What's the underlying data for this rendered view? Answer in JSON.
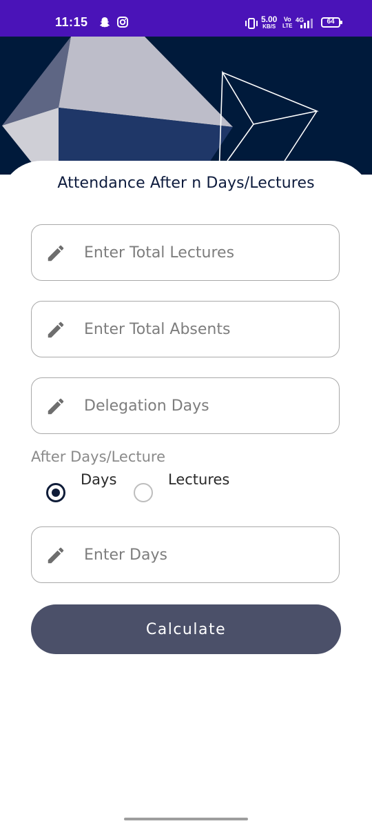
{
  "status_bar": {
    "time": "11:15",
    "speed_value": "5.00",
    "speed_unit": "KB/S",
    "volte_top": "Vo",
    "volte_bottom": "LTE",
    "network": "4G",
    "battery": "64",
    "background_color": "#4a13b8",
    "icons": [
      "snapchat-icon",
      "instagram-icon",
      "vibrate-icon",
      "signal-icon",
      "battery-icon"
    ]
  },
  "page": {
    "title": "Attendance After n Days/Lectures"
  },
  "form": {
    "total_lectures": {
      "placeholder": "Enter Total Lectures",
      "value": "",
      "icon": "pencil-icon"
    },
    "total_absents": {
      "placeholder": "Enter Total Absents",
      "value": "",
      "icon": "pencil-icon"
    },
    "delegation_days": {
      "placeholder": "Delegation Days",
      "value": "",
      "icon": "pencil-icon"
    },
    "section_label": "After Days/Lecture",
    "options": [
      {
        "label": "Days",
        "selected": true
      },
      {
        "label": "Lectures",
        "selected": false
      }
    ],
    "enter_days": {
      "placeholder": "Enter Days",
      "value": "",
      "icon": "pencil-icon"
    }
  },
  "actions": {
    "calculate_label": "Calculate",
    "button_color": "#4b5069"
  },
  "colors": {
    "hero_background": "#001a3b",
    "title_color": "#0d1b3d",
    "radio_selected": "#0f1c38"
  }
}
